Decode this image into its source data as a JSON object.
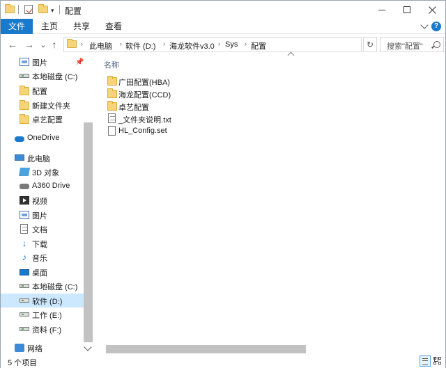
{
  "window": {
    "title": "配置",
    "quick_access_dropdown": "▾"
  },
  "ribbon": {
    "tabs": [
      "文件",
      "主页",
      "共享",
      "查看"
    ]
  },
  "navigation": {
    "back": "←",
    "forward": "→",
    "recent": "⌄",
    "up": "↑",
    "breadcrumb": [
      "此电脑",
      "软件 (D:)",
      "海龙软件v3.0",
      "Sys",
      "配置"
    ],
    "refresh": "↻",
    "search_placeholder": "搜索\"配置\""
  },
  "nav_pane": {
    "items": [
      {
        "label": "图片",
        "icon": "pictures-icon",
        "pinned": true
      },
      {
        "label": "本地磁盘 (C:)",
        "icon": "drive-icon"
      },
      {
        "label": "配置",
        "icon": "folder-icon"
      },
      {
        "label": "新建文件夹",
        "icon": "folder-icon"
      },
      {
        "label": "卓艺配置",
        "icon": "folder-icon"
      },
      {
        "label": "OneDrive",
        "icon": "onedrive-icon"
      },
      {
        "label": "此电脑",
        "icon": "this-pc-icon"
      },
      {
        "label": "3D 对象",
        "icon": "3d-objects-icon"
      },
      {
        "label": "A360 Drive",
        "icon": "a360-drive-icon"
      },
      {
        "label": "视频",
        "icon": "videos-icon"
      },
      {
        "label": "图片",
        "icon": "pictures-icon"
      },
      {
        "label": "文档",
        "icon": "documents-icon"
      },
      {
        "label": "下载",
        "icon": "downloads-icon"
      },
      {
        "label": "音乐",
        "icon": "music-icon"
      },
      {
        "label": "桌面",
        "icon": "desktop-icon"
      },
      {
        "label": "本地磁盘 (C:)",
        "icon": "drive-icon"
      },
      {
        "label": "软件 (D:)",
        "icon": "drive-icon",
        "selected": true
      },
      {
        "label": "工作 (E:)",
        "icon": "drive-icon"
      },
      {
        "label": "资料 (F:)",
        "icon": "drive-icon"
      },
      {
        "label": "网络",
        "icon": "network-icon"
      }
    ]
  },
  "content": {
    "column_header": "名称",
    "files": [
      {
        "name": "广田配置(HBA)",
        "type": "folder"
      },
      {
        "name": "海龙配置(CCD)",
        "type": "folder"
      },
      {
        "name": "卓艺配置",
        "type": "folder"
      },
      {
        "name": "_文件夹说明.txt",
        "type": "txt"
      },
      {
        "name": "HL_Config.set",
        "type": "file"
      }
    ]
  },
  "status": {
    "item_count": "5 个项目"
  },
  "colors": {
    "accent": "#1979ca",
    "selection": "#cce8ff",
    "folder": "#f6d57a"
  }
}
